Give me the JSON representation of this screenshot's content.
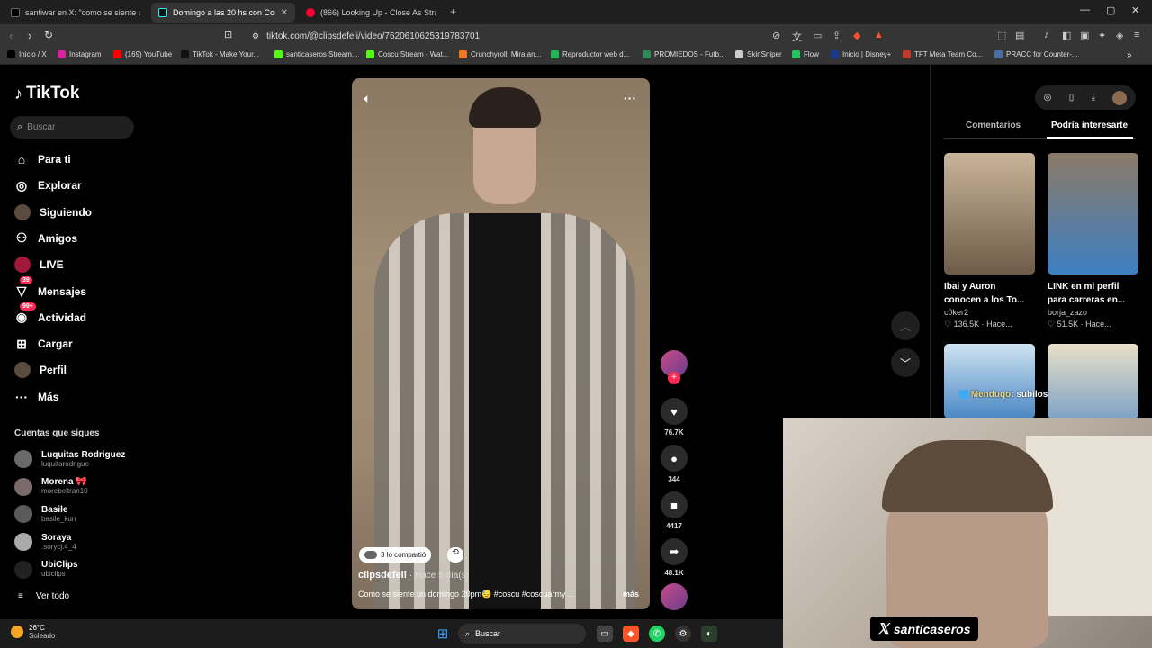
{
  "browser": {
    "tabs": [
      {
        "title": "santiwar en X: \"como se siente un do",
        "color": "#000000"
      },
      {
        "title": "Domingo a las 20 hs con Cos",
        "color": "#111111"
      },
      {
        "title": "(866) Looking Up - Close As Strange",
        "color": "#ff0033"
      }
    ],
    "url": "tiktok.com/@clipsdefeli/video/7620610625319783701",
    "bookmarks": [
      {
        "label": "Inicio / X",
        "color": "#000000"
      },
      {
        "label": "Instagram",
        "color": "#d6249f"
      },
      {
        "label": "(169) YouTube",
        "color": "#ff0000"
      },
      {
        "label": "TikTok - Make Your...",
        "color": "#111111"
      },
      {
        "label": "santicaseros Stream...",
        "color": "#53fc18"
      },
      {
        "label": "Coscu Stream - Wat...",
        "color": "#53fc18"
      },
      {
        "label": "Crunchyroll: Mira an...",
        "color": "#f47521"
      },
      {
        "label": "Reproductor web d...",
        "color": "#1db954"
      },
      {
        "label": "PROMIEDOS - Futb...",
        "color": "#2e8b57"
      },
      {
        "label": "SkinSniper",
        "color": "#cccccc"
      },
      {
        "label": "Flow",
        "color": "#22c55e"
      },
      {
        "label": "Inicio | Disney+",
        "color": "#1a3a8a"
      },
      {
        "label": "TFT Meta Team Co...",
        "color": "#c0392b"
      },
      {
        "label": "PRACC for Counter-...",
        "color": "#4a6fa5"
      }
    ]
  },
  "tiktok": {
    "logo": "TikTok",
    "search_placeholder": "Buscar",
    "nav": [
      {
        "label": "Para ti",
        "icon": "home-icon"
      },
      {
        "label": "Explorar",
        "icon": "compass-icon"
      },
      {
        "label": "Siguiendo",
        "icon": "avatar-icon"
      },
      {
        "label": "Amigos",
        "icon": "friends-icon"
      },
      {
        "label": "LIVE",
        "icon": "live-icon"
      },
      {
        "label": "Mensajes",
        "icon": "messages-icon",
        "badge": "39"
      },
      {
        "label": "Actividad",
        "icon": "activity-icon",
        "badge": "99+"
      },
      {
        "label": "Cargar",
        "icon": "upload-icon"
      },
      {
        "label": "Perfil",
        "icon": "profile-icon"
      },
      {
        "label": "Más",
        "icon": "more-icon"
      }
    ],
    "following_heading": "Cuentas que sigues",
    "following": [
      {
        "name": "Luquitas Rodriguez",
        "handle": "luquitarodrigue"
      },
      {
        "name": "Morena 🎀",
        "handle": "morebeltran10"
      },
      {
        "name": "Basile",
        "handle": "basile_kun"
      },
      {
        "name": "Soraya",
        "handle": ".sorycj.4_4"
      },
      {
        "name": "UbiClips",
        "handle": "ubiclips"
      }
    ],
    "ver_todo": "Ver todo",
    "video": {
      "shared": "3 lo compartió",
      "author": "clipsdefeli",
      "when": "· Hace 5 día(s)",
      "caption": "Como se siente un domingo 20pm😓  #coscu #coscuarmy ...",
      "more": "más"
    },
    "actions": {
      "likes": "76.7K",
      "comments": "344",
      "saves": "4417",
      "shares": "48.1K"
    },
    "right_tabs": {
      "comments": "Comentarios",
      "suggested": "Podría interesarte"
    },
    "cards": [
      {
        "title1": "Ibai y Auron",
        "title2": "conocen a los To...",
        "author": "c0ker2",
        "stats": "♡ 136.5K · Hace...",
        "thumb_top": "#c9b49a",
        "thumb_bot": "#6f5b47"
      },
      {
        "title1": "LINK en mi perfil",
        "title2": "para carreras en...",
        "author": "borja_zazo",
        "stats": "♡ 51.5K · Hace...",
        "thumb_top": "#8c7a66",
        "thumb_bot": "#3d7fc2"
      },
      {
        "title1": "",
        "title2": "",
        "author": "",
        "stats": "",
        "thumb_top": "#cfe3f1",
        "thumb_bot": "#4a88c4"
      },
      {
        "title1": "",
        "title2": "",
        "author": "",
        "stats": "",
        "thumb_top": "#e9e0c7",
        "thumb_bot": "#7ea3c6"
      }
    ]
  },
  "stream": {
    "chat_name": "Menduqo",
    "chat_msg": ": subilos",
    "tag": "santicaseros"
  },
  "taskbar": {
    "temp": "26°C",
    "weather": "Soleado",
    "search": "Buscar"
  }
}
